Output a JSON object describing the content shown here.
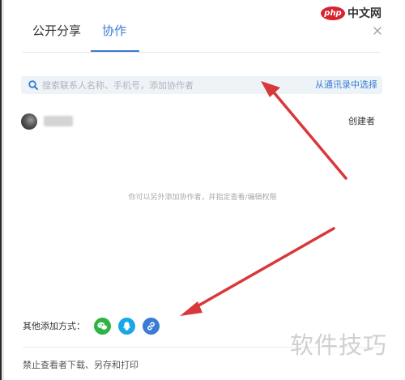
{
  "tabs": {
    "public_share": "公开分享",
    "collaborate": "协作"
  },
  "search": {
    "placeholder": "搜索联系人名称、手机号，添加协作者",
    "contacts_link": "从通讯录中选择"
  },
  "member": {
    "name": "",
    "role": "创建者"
  },
  "hint": "你可以另外添加协作者，并指定查看/编辑权限",
  "other_ways": {
    "label": "其他添加方式：",
    "icons": [
      "wechat-icon",
      "qq-icon",
      "link-icon"
    ]
  },
  "footer": {
    "disable_text": "禁止查看者下载、另存和打印"
  },
  "watermarks": {
    "top_badge": "php",
    "top_text": "中文网",
    "bottom_text": "软件技巧"
  },
  "colors": {
    "accent": "#3a7bd5",
    "wechat": "#2fb344",
    "qq": "#1aa7e8",
    "arrow": "#d8383a"
  }
}
